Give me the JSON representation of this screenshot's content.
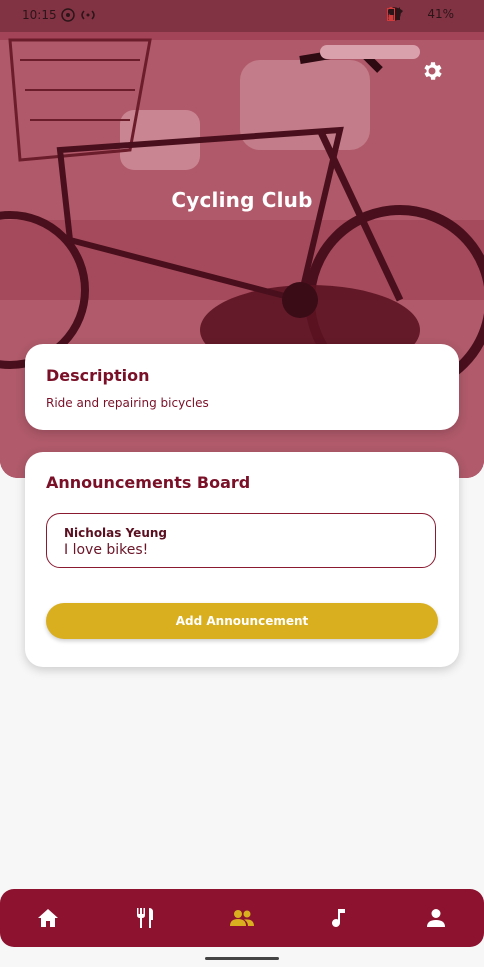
{
  "status_bar": {
    "time": "10:15",
    "battery": "41%"
  },
  "header": {
    "title": "Cycling Club",
    "settings_icon": "gear-icon",
    "overlay_color": "#9e3a4f"
  },
  "description_card": {
    "title": "Description",
    "text": "Ride and repairing bicycles"
  },
  "announcements_card": {
    "title": "Announcements Board",
    "items": [
      {
        "author": "Nicholas Yeung",
        "text": "I love bikes!"
      }
    ],
    "add_button_label": "Add Announcement"
  },
  "bottom_nav": {
    "items": [
      {
        "icon": "home-icon",
        "active": false
      },
      {
        "icon": "restaurant-icon",
        "active": false
      },
      {
        "icon": "group-icon",
        "active": true
      },
      {
        "icon": "music-note-icon",
        "active": false
      },
      {
        "icon": "person-icon",
        "active": false
      }
    ],
    "active_color": "#d9ae1f",
    "inactive_color": "#ffffff"
  },
  "colors": {
    "accent": "#7a1028",
    "button": "#d9ae1f",
    "nav_bg": "#8c1230"
  }
}
